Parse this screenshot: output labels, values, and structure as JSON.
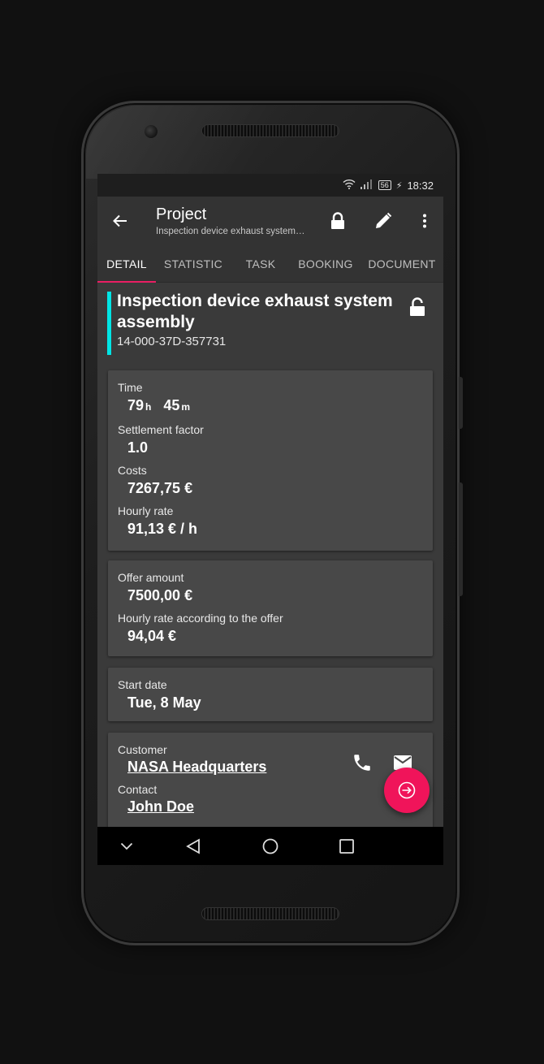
{
  "status": {
    "time": "18:32",
    "battery": "56"
  },
  "appbar": {
    "title": "Project",
    "subtitle": "Inspection device exhaust system…"
  },
  "tabs": [
    "DETAIL",
    "STATISTIC",
    "TASK",
    "BOOKING",
    "DOCUMENT"
  ],
  "project": {
    "title": "Inspection device exhaust system assembly",
    "number": "14-000-37D-357731"
  },
  "summary": {
    "time_label": "Time",
    "hours": "79",
    "hours_unit": "h",
    "minutes": "45",
    "minutes_unit": "m",
    "factor_label": "Settlement factor",
    "factor": "1.0",
    "costs_label": "Costs",
    "costs": "7267,75 €",
    "rate_label": "Hourly rate",
    "rate": "91,13 € / h"
  },
  "offer": {
    "amount_label": "Offer amount",
    "amount": "7500,00 €",
    "rate_label": "Hourly rate according to the offer",
    "rate": "94,04 €"
  },
  "dates": {
    "start_label": "Start date",
    "start": "Tue, 8 May"
  },
  "customer": {
    "label": "Customer",
    "name": "NASA Headquarters",
    "contact_label": "Contact",
    "contact": "John Doe"
  },
  "colors": {
    "accent": "#e91e63",
    "fab": "#f0145a",
    "project_bar": "#00e5e5"
  },
  "icons": [
    "wifi-icon",
    "signal-icon",
    "battery-icon",
    "back-arrow-icon",
    "lock-icon",
    "edit-pencil-icon",
    "more-vert-icon",
    "phone-icon",
    "mail-icon",
    "login-arrow-icon",
    "nav-collapse-icon",
    "nav-back-icon",
    "nav-home-icon",
    "nav-recents-icon"
  ]
}
